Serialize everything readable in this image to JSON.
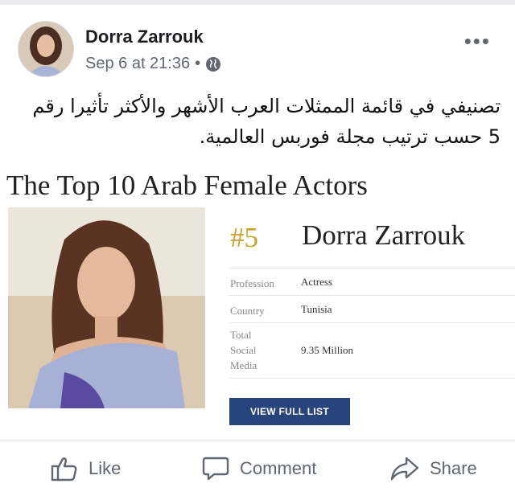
{
  "post": {
    "author": "Dorra Zarrouk",
    "timestamp": "Sep 6 at 21:36",
    "separator": "•",
    "privacy_icon": "globe-icon",
    "more_label": "•••",
    "text": "تصنيفي في قائمة الممثلات العرب الأشهر والأكثر تأثيرا رقم 5 حسب ترتيب مجلة فوربس العالمية."
  },
  "card": {
    "title": "The Top 10 Arab Female Actors",
    "rank": "#5",
    "name": "Dorra Zarrouk",
    "rows": [
      {
        "label": "Profession",
        "value": "Actress"
      },
      {
        "label": "Country",
        "value": "Tunisia"
      },
      {
        "label": "Total Social Media",
        "value": "9.35 Million"
      }
    ],
    "button_label": "VIEW FULL LIST"
  },
  "actions": {
    "like": "Like",
    "comment": "Comment",
    "share": "Share"
  },
  "colors": {
    "accent_button": "#27457a",
    "rank_gold": "#c9a227",
    "meta_gray": "#606770"
  }
}
